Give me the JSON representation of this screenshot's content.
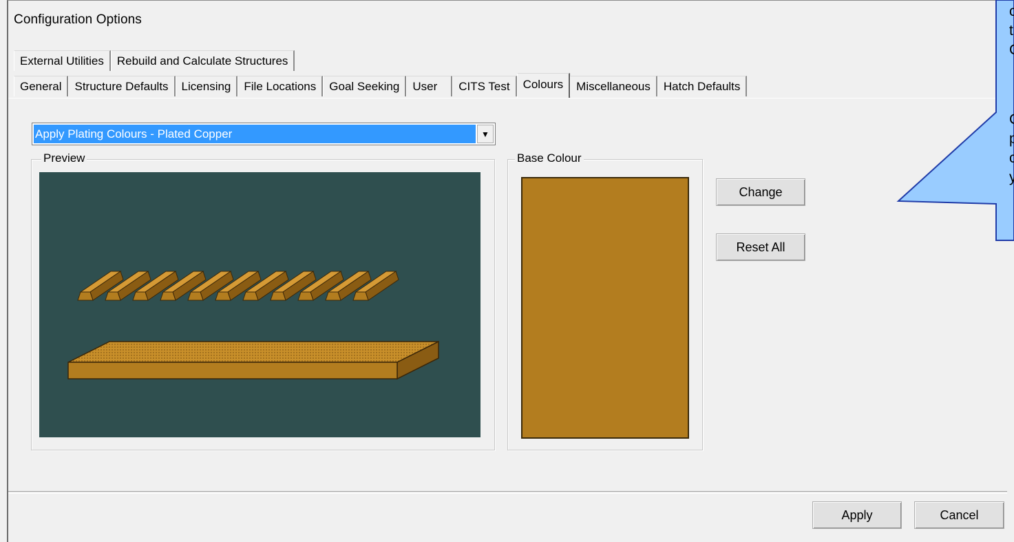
{
  "window": {
    "title": "Configuration Options"
  },
  "tabs": {
    "back_row": [
      "External Utilities",
      "Rebuild and Calculate Structures"
    ],
    "front_row": [
      "General",
      "Structure Defaults",
      "Licensing",
      "File Locations",
      "Goal Seeking",
      "User",
      "CITS Test",
      "Colours",
      "Miscellaneous",
      "Hatch Defaults"
    ],
    "active": "Colours"
  },
  "colours": {
    "dropdown_value": "Apply Plating Colours - Plated Copper",
    "preview_label": "Preview",
    "base_colour_label": "Base Colour",
    "base_colour": "#b37d1f",
    "preview_background": "#2f4f4f",
    "change_label": "Change",
    "reset_all_label": "Reset All"
  },
  "footer": {
    "apply_label": "Apply",
    "cancel_label": "Cancel"
  },
  "callout": {
    "fill": "#99ccff",
    "border": "#1f3ba8",
    "visible_fragments": [
      "c",
      "t",
      "C",
      "C",
      "p",
      "c",
      "y"
    ]
  }
}
